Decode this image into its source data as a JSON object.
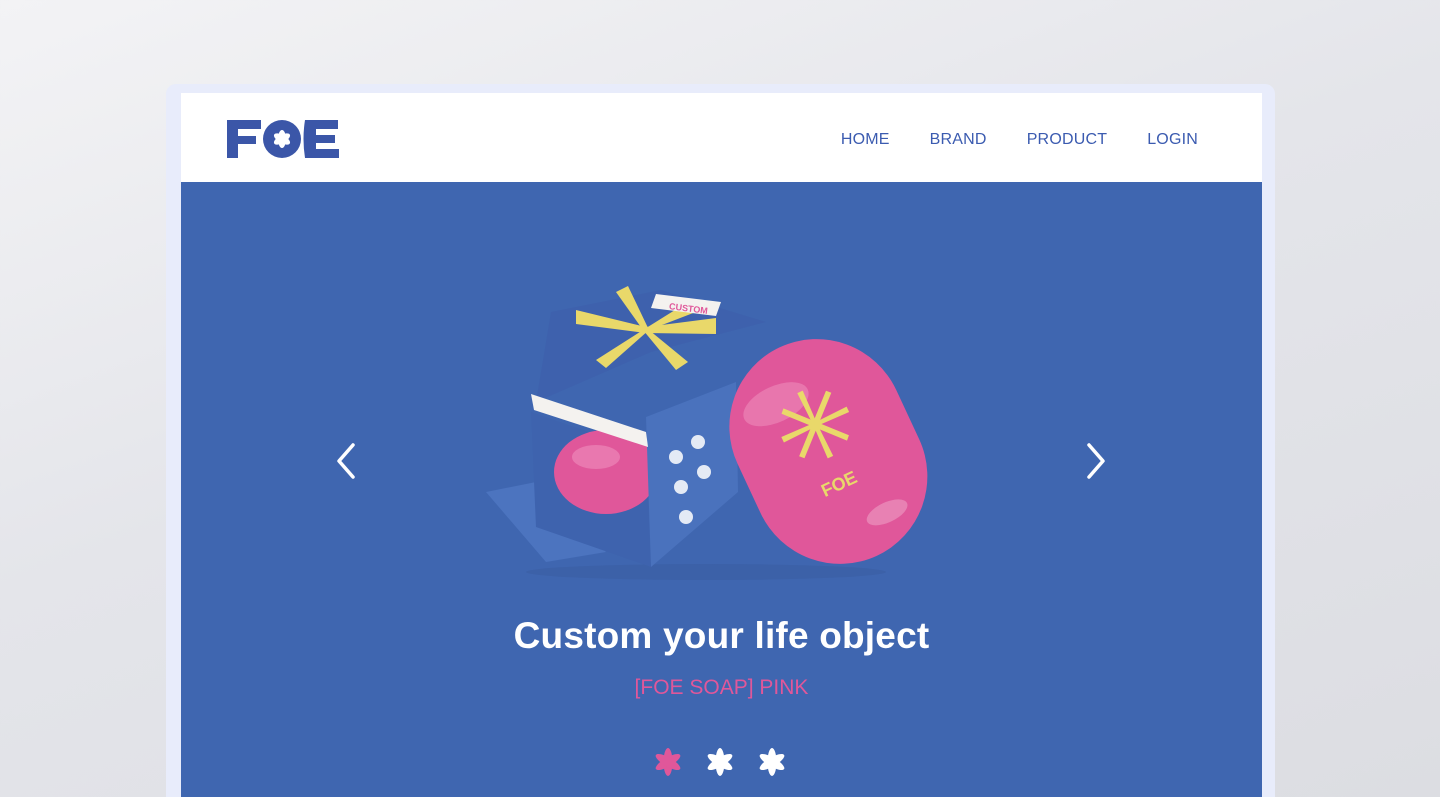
{
  "brand": {
    "logo_text": "FOE",
    "primary_color": "#3f66b0",
    "accent_pink": "#e0579a",
    "accent_yellow": "#e9d86a"
  },
  "nav": {
    "items": [
      {
        "label": "HOME"
      },
      {
        "label": "BRAND"
      },
      {
        "label": "PRODUCT"
      },
      {
        "label": "LOGIN"
      }
    ]
  },
  "hero": {
    "headline": "Custom your life object",
    "subline": "[FOE SOAP] PINK",
    "image_alt_icon": "soap-product-image",
    "prev_icon": "chevron-left-icon",
    "next_icon": "chevron-right-icon",
    "slides": [
      {
        "icon": "flower-dot-icon",
        "active": true
      },
      {
        "icon": "flower-dot-icon",
        "active": false
      },
      {
        "icon": "flower-dot-icon",
        "active": false
      }
    ],
    "product_box_label": "CUSTOM",
    "product_soap_label": "FOE"
  }
}
